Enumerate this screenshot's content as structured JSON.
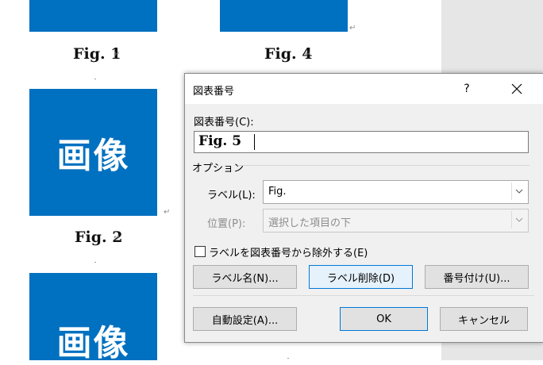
{
  "document": {
    "image_label": "画像",
    "captions": {
      "fig1": "Fig. 1",
      "fig4": "Fig. 4",
      "fig2": "Fig. 2"
    },
    "para_mark": "↵"
  },
  "dialog": {
    "title": "図表番号",
    "help_label": "?",
    "caption_label": "図表番号(C):",
    "caption_value": "Fig. 5",
    "options_label": "オプション",
    "label_field_label": "ラベル(L):",
    "label_value": "Fig.",
    "position_label": "位置(P):",
    "position_value": "選択した項目の下",
    "exclude_label": "ラベルを図表番号から除外する(E)",
    "buttons": {
      "new_label": "ラベル名(N)...",
      "delete_label": "ラベル削除(D)",
      "numbering": "番号付け(U)...",
      "autocaption": "自動設定(A)...",
      "ok": "OK",
      "cancel": "キャンセル"
    }
  },
  "colors": {
    "image_blue": "#0070c0",
    "focus_blue": "#0078d7",
    "side_gray": "#e6e6e6"
  }
}
